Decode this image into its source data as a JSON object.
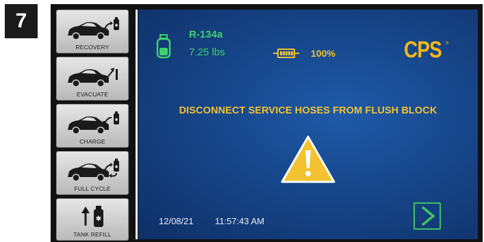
{
  "step_number": "7",
  "sidebar": {
    "items": [
      {
        "label": "RECOVERY",
        "icon": "car-recovery-icon"
      },
      {
        "label": "EVACUATE",
        "icon": "car-evacuate-icon"
      },
      {
        "label": "CHARGE",
        "icon": "car-charge-icon"
      },
      {
        "label": "FULL CYCLE",
        "icon": "car-full-cycle-icon"
      },
      {
        "label": "TANK REFILL",
        "icon": "tank-refill-icon"
      }
    ]
  },
  "status": {
    "refrigerant": "R-134a",
    "weight": "7.25 lbs",
    "battery_percent": "100%",
    "brand": "CPS",
    "brand_mark": "®"
  },
  "message": "DISCONNECT SERVICE HOSES FROM FLUSH BLOCK",
  "footer": {
    "date": "12/08/21",
    "time": "11:57:43 AM",
    "next_icon": "chevron-right-icon"
  },
  "colors": {
    "status_green": "#3fd06e",
    "accent_yellow": "#f2c230",
    "screen_blue": "#17468a",
    "next_green": "#3fc45e"
  }
}
